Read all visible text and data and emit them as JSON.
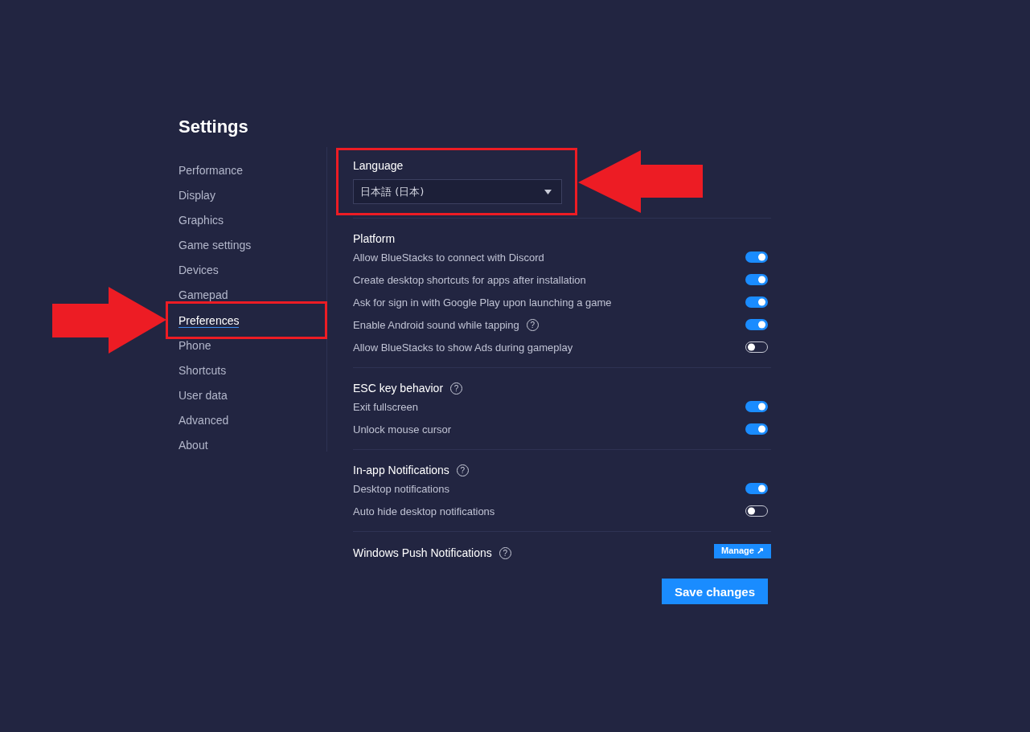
{
  "title": "Settings",
  "sidebar": {
    "items": [
      {
        "label": "Performance",
        "selected": false
      },
      {
        "label": "Display",
        "selected": false
      },
      {
        "label": "Graphics",
        "selected": false
      },
      {
        "label": "Game settings",
        "selected": false
      },
      {
        "label": "Devices",
        "selected": false
      },
      {
        "label": "Gamepad",
        "selected": false
      },
      {
        "label": "Preferences",
        "selected": true
      },
      {
        "label": "Phone",
        "selected": false
      },
      {
        "label": "Shortcuts",
        "selected": false
      },
      {
        "label": "User data",
        "selected": false
      },
      {
        "label": "Advanced",
        "selected": false
      },
      {
        "label": "About",
        "selected": false
      }
    ]
  },
  "sections": [
    {
      "kind": "dropdown",
      "title": "Language",
      "value": "日本語 (日本)"
    },
    {
      "kind": "toggles",
      "title": "Platform",
      "items": [
        {
          "label": "Allow BlueStacks to connect with Discord",
          "on": true
        },
        {
          "label": "Create desktop shortcuts for apps after installation",
          "on": true
        },
        {
          "label": "Ask for sign in with Google Play upon launching a game",
          "on": true
        },
        {
          "label": "Enable Android sound while tapping",
          "help_icon": "?",
          "on": true
        },
        {
          "label": "Allow BlueStacks to show Ads during gameplay",
          "on": false
        }
      ]
    },
    {
      "kind": "toggles",
      "title": "ESC key behavior",
      "help_icon": "?",
      "items": [
        {
          "label": "Exit fullscreen",
          "on": true
        },
        {
          "label": "Unlock mouse cursor",
          "on": true
        }
      ]
    },
    {
      "kind": "toggles",
      "title": "In-app Notifications",
      "help_icon": "?",
      "items": [
        {
          "label": "Desktop notifications",
          "on": true
        },
        {
          "label": "Auto hide desktop notifications",
          "on": false
        }
      ]
    },
    {
      "kind": "action",
      "title": "Windows Push Notifications",
      "help_icon": "?",
      "button": "Manage ↗"
    }
  ],
  "save_button": "Save changes"
}
